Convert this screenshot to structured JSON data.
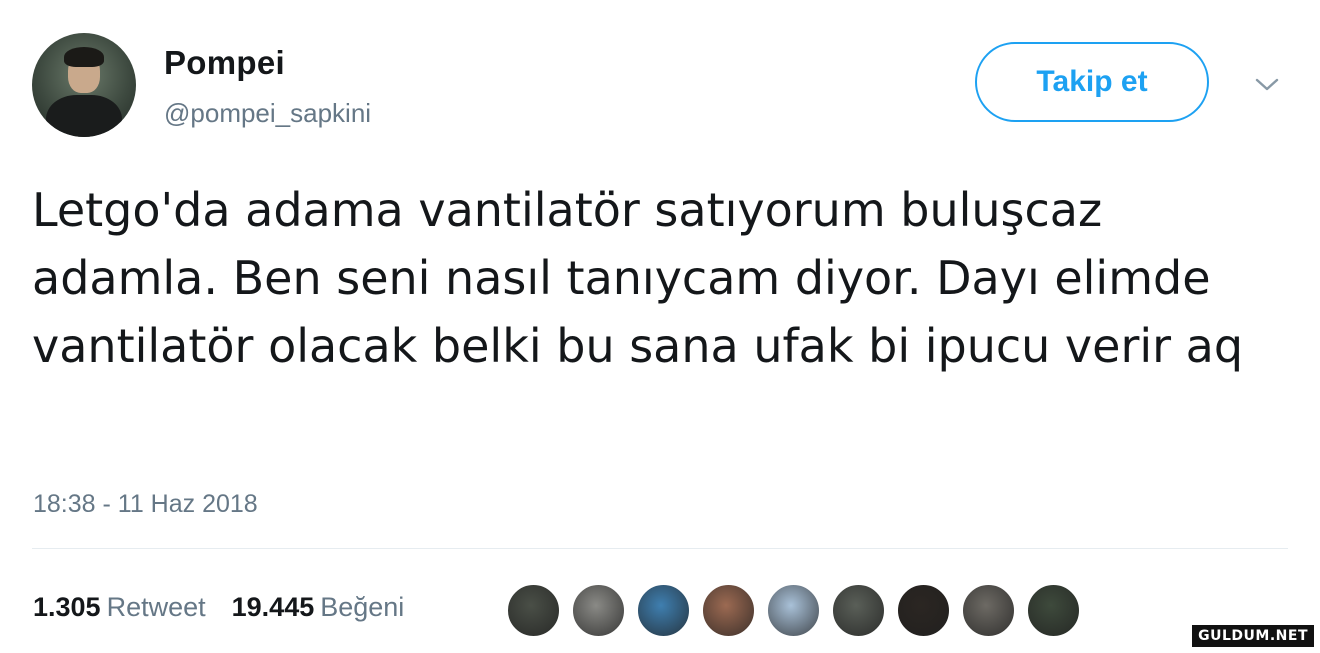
{
  "tweet": {
    "author": {
      "name": "Pompei",
      "handle": "@pompei_sapkini"
    },
    "follow_button_label": "Takip et",
    "text": "Letgo'da adama vantilatör satıyorum buluşcaz adamla. Ben seni nasıl tanıycam diyor. Dayı elimde vantilatör olacak belki bu sana ufak bi ipucu verir aq",
    "timestamp": "18:38 - 11 Haz 2018",
    "stats": {
      "retweets_count": "1.305",
      "retweets_label": "Retweet",
      "likes_count": "19.445",
      "likes_label": "Beğeni"
    },
    "likers": [
      {
        "color": "#4a4f47"
      },
      {
        "color": "#8a8a86"
      },
      {
        "color": "#3f7fb0"
      },
      {
        "color": "#9c6a52"
      },
      {
        "color": "#a9c1d8"
      },
      {
        "color": "#5a5f58"
      },
      {
        "color": "#2b2622"
      },
      {
        "color": "#6d6a64"
      },
      {
        "color": "#3e4a3c"
      }
    ]
  },
  "watermark": "GULDUM.NET",
  "colors": {
    "accent": "#1da1f2",
    "secondary_text": "#657786",
    "primary_text": "#14171a"
  }
}
